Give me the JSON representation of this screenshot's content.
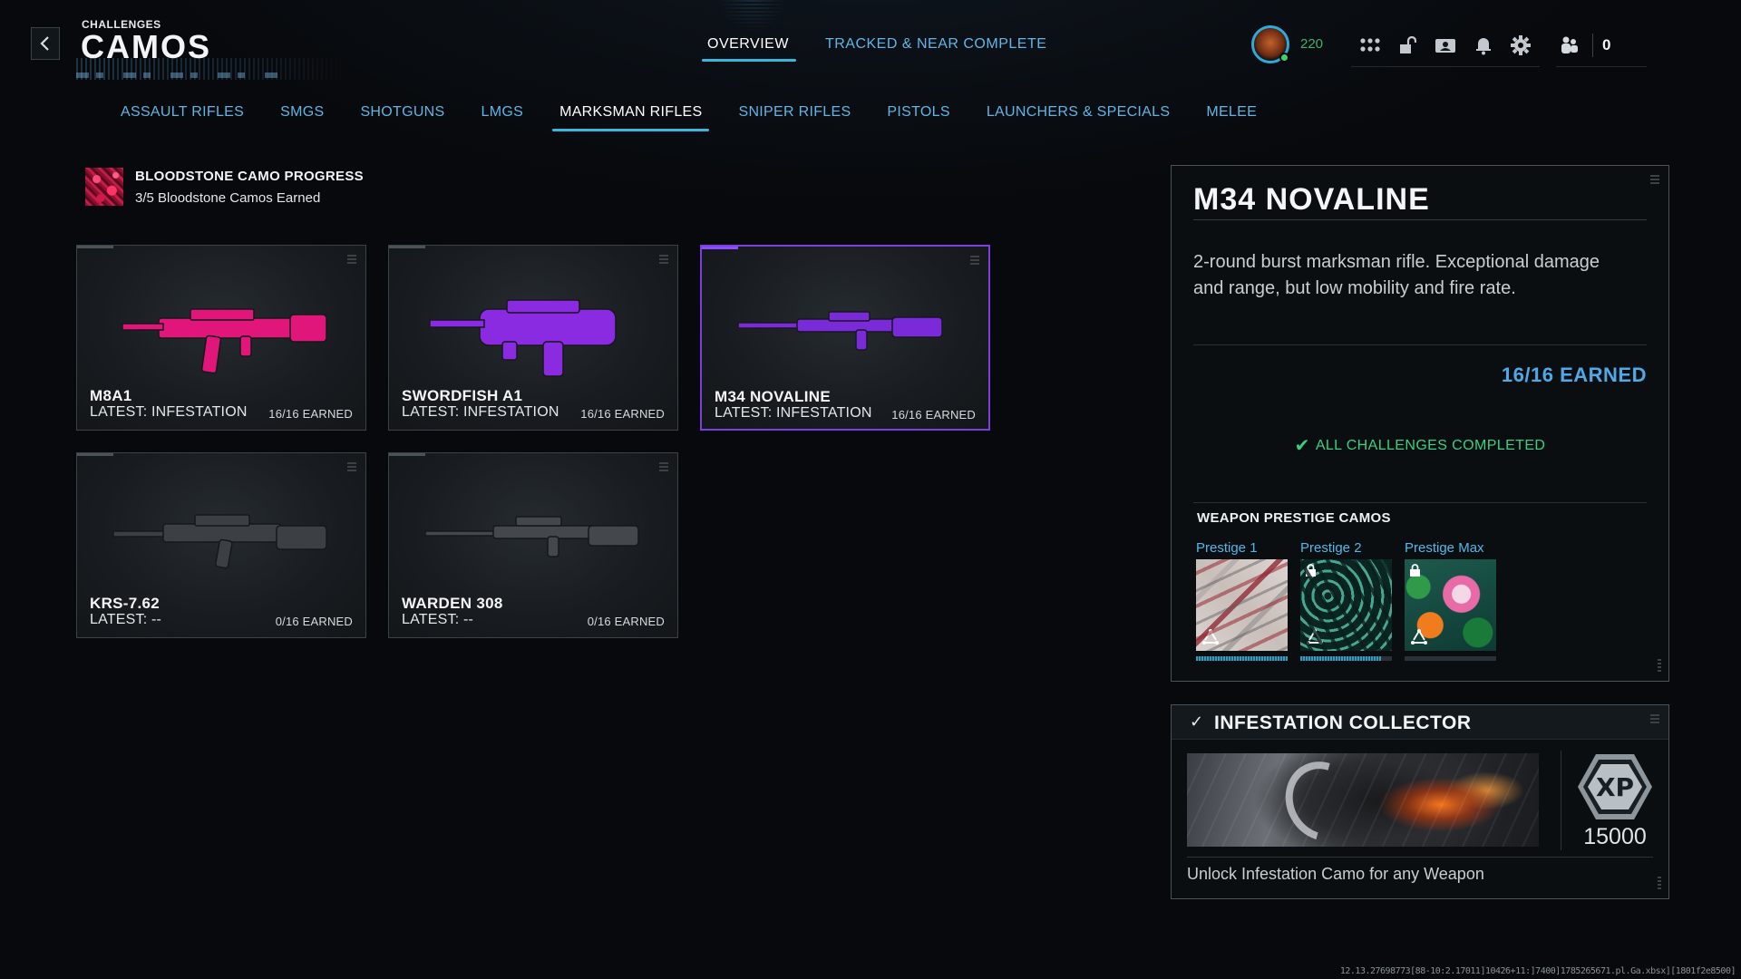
{
  "header": {
    "kicker": "CHALLENGES",
    "title": "CAMOS",
    "back_icon": "chevron-left-icon",
    "tabs": [
      {
        "label": "OVERVIEW",
        "active": true
      },
      {
        "label": "TRACKED & NEAR COMPLETE",
        "active": false
      }
    ]
  },
  "hud": {
    "level": "220",
    "icons": [
      "apps-grid-icon",
      "unlock-icon",
      "id-card-icon",
      "bell-icon",
      "gear-icon"
    ],
    "party_icon": "party-icon",
    "party_count": "0"
  },
  "categories": [
    {
      "label": "ASSAULT RIFLES",
      "active": false
    },
    {
      "label": "SMGS",
      "active": false
    },
    {
      "label": "SHOTGUNS",
      "active": false
    },
    {
      "label": "LMGS",
      "active": false
    },
    {
      "label": "MARKSMAN RIFLES",
      "active": true
    },
    {
      "label": "SNIPER RIFLES",
      "active": false
    },
    {
      "label": "PISTOLS",
      "active": false
    },
    {
      "label": "LAUNCHERS & SPECIALS",
      "active": false
    },
    {
      "label": "MELEE",
      "active": false
    }
  ],
  "progress": {
    "title": "BLOODSTONE CAMO PROGRESS",
    "subtitle": "3/5 Bloodstone Camos Earned"
  },
  "weapons": [
    {
      "name": "M8A1",
      "latest": "LATEST: INFESTATION",
      "earned": "16/16 EARNED",
      "camo_color": "#e0167a",
      "selected": false
    },
    {
      "name": "SWORDFISH A1",
      "latest": "LATEST: INFESTATION",
      "earned": "16/16 EARNED",
      "camo_color": "#8a2be2",
      "selected": false
    },
    {
      "name": "M34 NOVALINE",
      "latest": "LATEST: INFESTATION",
      "earned": "16/16 EARNED",
      "camo_color": "#7a2ad8",
      "selected": true
    },
    {
      "name": "KRS-7.62",
      "latest": "LATEST: --",
      "earned": "0/16 EARNED",
      "camo_color": "#3c3f43",
      "selected": false
    },
    {
      "name": "WARDEN 308",
      "latest": "LATEST: --",
      "earned": "0/16 EARNED",
      "camo_color": "#44484c",
      "selected": false
    }
  ],
  "detail": {
    "name": "M34 NOVALINE",
    "description": "2-round burst marksman rifle. Exceptional damage and range, but low mobility and fire rate.",
    "earned": "16/16 EARNED",
    "status": "ALL CHALLENGES COMPLETED",
    "prestige_title": "WEAPON PRESTIGE CAMOS",
    "prestige": [
      {
        "label": "Prestige 1",
        "locked": false,
        "progress": 1.0
      },
      {
        "label": "Prestige 2",
        "locked": true,
        "progress": 0.88
      },
      {
        "label": "Prestige Max",
        "locked": true,
        "progress": 0.0
      }
    ]
  },
  "reward": {
    "title": "INFESTATION COLLECTOR",
    "xp_label": "XP",
    "xp_value": "15000",
    "description": "Unlock Infestation Camo for any Weapon"
  },
  "build": "12.13.27698773[88-10:2.17011]10426+11:]7400]1785265671.pl.Ga.xbsx][1801f2e8500]",
  "colors": {
    "accent_blue": "#39b6dc",
    "tab_text": "#5fb6e6",
    "complete_green": "#37d183",
    "selected_border": "#7b3fe0"
  }
}
